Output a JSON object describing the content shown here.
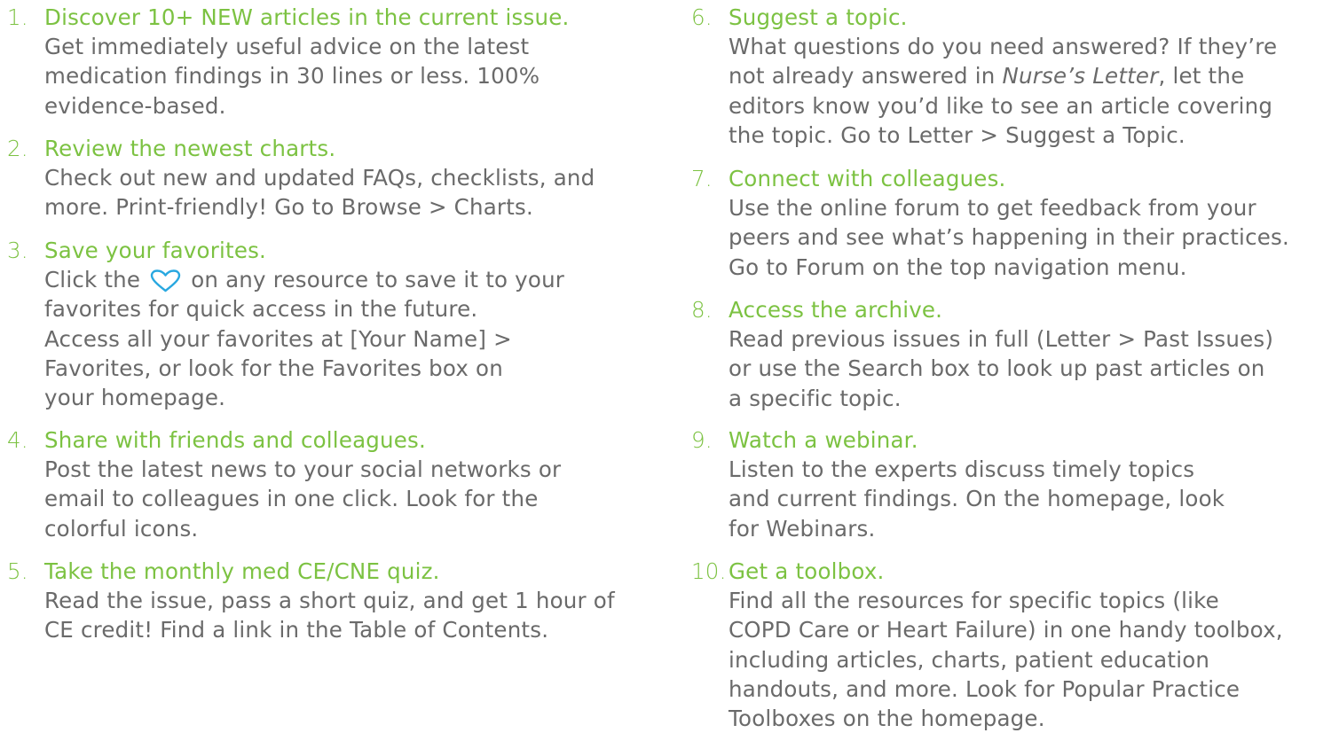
{
  "colors": {
    "heading": "#7cc242",
    "body": "#6a6a6a",
    "heart": "#29a8e0"
  },
  "icons": {
    "favorite": "heart-icon"
  },
  "items": [
    {
      "number": "1.",
      "heading": "Discover 10+ NEW articles in the current issue.",
      "lines": [
        "Get immediately useful advice on the latest",
        "medication findings in 30 lines or less. 100%",
        "evidence-based."
      ]
    },
    {
      "number": "2.",
      "heading": "Review the newest charts.",
      "lines": [
        "Check out new and updated FAQs, checklists, and",
        "more. Print-friendly! Go to Browse > Charts."
      ]
    },
    {
      "number": "3.",
      "heading": "Save your favorites.",
      "line1_before": "Click the",
      "line1_after": "on any resource to save it to your",
      "lines": [
        "favorites for quick access in the future.",
        "Access all your favorites at [Your Name] >",
        "Favorites, or look for the Favorites box on",
        "your homepage."
      ]
    },
    {
      "number": "4.",
      "heading": "Share with friends and colleagues.",
      "lines": [
        "Post the latest news to your social networks or",
        "email to colleagues in one click. Look for the",
        "colorful icons."
      ]
    },
    {
      "number": "5.",
      "heading": "Take the monthly med CE/CNE quiz.",
      "lines": [
        "Read the issue, pass a short quiz, and get 1 hour of",
        "CE credit! Find a link in the Table of Contents."
      ]
    },
    {
      "number": "6.",
      "heading": "Suggest a topic.",
      "line1": "What questions do you need answered? If they’re",
      "line2_before": "not already answered in ",
      "line2_italic": "Nurse’s Letter",
      "line2_after": ", let the",
      "lines": [
        "editors know you’d like to see an article covering",
        "the topic. Go to Letter > Suggest a Topic."
      ]
    },
    {
      "number": "7.",
      "heading": "Connect with colleagues.",
      "lines": [
        "Use the online forum to get feedback from your",
        "peers and see what’s happening in their practices.",
        "Go to Forum on the top navigation menu."
      ]
    },
    {
      "number": "8.",
      "heading": "Access the archive.",
      "lines": [
        "Read previous issues in full (Letter > Past Issues)",
        "or use the Search box to look up past articles on",
        "a specific topic."
      ]
    },
    {
      "number": "9.",
      "heading": "Watch a webinar.",
      "lines": [
        "Listen to the experts discuss timely topics",
        "and current findings. On the homepage, look",
        "for Webinars."
      ]
    },
    {
      "number": "10.",
      "heading": "Get a toolbox.",
      "lines": [
        "Find all the resources for specific topics (like",
        "COPD Care or Heart Failure) in one handy toolbox,",
        "including articles, charts, patient education",
        "handouts, and more. Look for Popular Practice",
        "Toolboxes on the homepage."
      ]
    }
  ]
}
